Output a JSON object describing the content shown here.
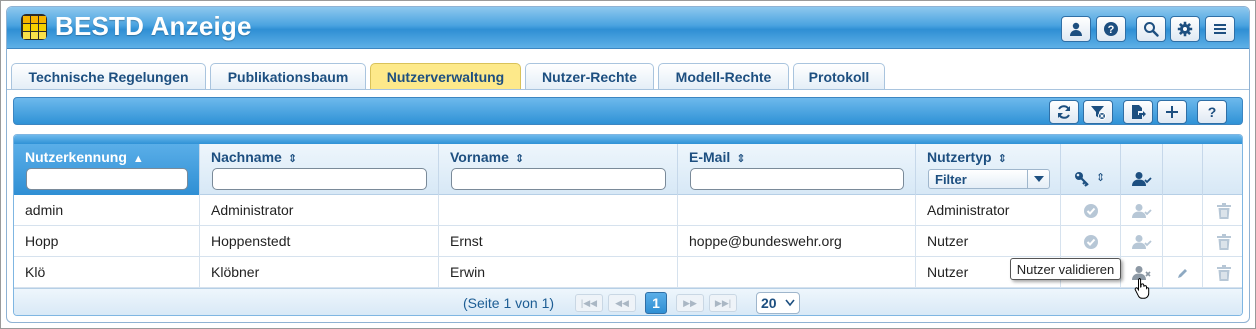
{
  "app": {
    "title": "BESTD Anzeige"
  },
  "header_buttons": [
    {
      "icon": "user-icon"
    },
    {
      "icon": "help-icon"
    },
    {
      "icon": "search-icon"
    },
    {
      "icon": "gear-icon"
    },
    {
      "icon": "menu-icon"
    }
  ],
  "tabs": [
    {
      "label": "Technische Regelungen",
      "active": false
    },
    {
      "label": "Publikationsbaum",
      "active": false
    },
    {
      "label": "Nutzerverwaltung",
      "active": true
    },
    {
      "label": "Nutzer-Rechte",
      "active": false
    },
    {
      "label": "Modell-Rechte",
      "active": false
    },
    {
      "label": "Protokoll",
      "active": false
    }
  ],
  "toolbar": {
    "buttons": [
      {
        "icon": "refresh-icon"
      },
      {
        "icon": "filter-clear-icon"
      },
      {
        "icon": "export-icon"
      },
      {
        "icon": "plus-icon"
      },
      {
        "icon": "help-icon",
        "label": "?"
      }
    ]
  },
  "table": {
    "columns": [
      {
        "label": "Nutzerkennung",
        "sort": "asc"
      },
      {
        "label": "Nachname",
        "sort": "both"
      },
      {
        "label": "Vorname",
        "sort": "both"
      },
      {
        "label": "E-Mail",
        "sort": "both"
      },
      {
        "label": "Nutzertyp",
        "sort": "both",
        "filter_value": "Filter"
      },
      {
        "icon": "key-icon",
        "sort": "both"
      },
      {
        "icon": "user-check-icon"
      },
      {
        "icon": ""
      },
      {
        "icon": ""
      }
    ],
    "rows": [
      {
        "kennung": "admin",
        "nachname": "Administrator",
        "vorname": "",
        "email": "",
        "typ": "Administrator",
        "validated": true,
        "editable": false
      },
      {
        "kennung": "Hopp",
        "nachname": "Hoppenstedt",
        "vorname": "Ernst",
        "email": "hoppe@bundeswehr.org",
        "typ": "Nutzer",
        "validated": true,
        "editable": false
      },
      {
        "kennung": "Klö",
        "nachname": "Klöbner",
        "vorname": "Erwin",
        "email": "",
        "typ": "Nutzer",
        "validated": false,
        "editable": true
      }
    ]
  },
  "pager": {
    "info": "(Seite 1 von 1)",
    "current_page": "1",
    "page_size": "20"
  },
  "tooltip": {
    "text": "Nutzer validieren"
  },
  "colors": {
    "accent": "#2f8fd4",
    "active_tab": "#fde98a",
    "text_blue": "#1d4f80"
  }
}
